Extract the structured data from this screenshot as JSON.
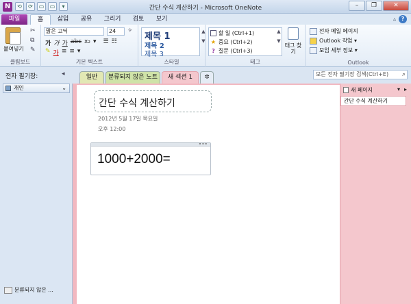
{
  "window": {
    "title": "간단 수식 계산하기 - Microsoft OneNote",
    "logo": "N"
  },
  "qat": [
    "⟲",
    "⟳",
    "▭",
    "▭",
    "▾"
  ],
  "winbtns": {
    "minimize": "–",
    "restore": "❐",
    "close": "✕"
  },
  "ribbon_tabs": {
    "file": "파일",
    "tabs": [
      "홈",
      "삽입",
      "공유",
      "그리기",
      "검토",
      "보기"
    ],
    "active": "홈"
  },
  "clipboard": {
    "paste": "붙여넣기",
    "group": "클립보드"
  },
  "basic_text": {
    "font": "맑은 고딕",
    "size": "24",
    "group": "기본 텍스트",
    "row1": [
      "가",
      "가",
      "가",
      "abc",
      "x₂",
      "▾"
    ],
    "row2": [
      "✎",
      "가",
      "≡",
      "≡",
      "▾"
    ]
  },
  "styles": {
    "h1": "제목 1",
    "h2": "제목 2",
    "h3": "제목 3",
    "group": "스타일"
  },
  "tags": {
    "items": [
      "할 일 (Ctrl+1)",
      "중요 (Ctrl+2)",
      "질문 (Ctrl+3)"
    ],
    "find": "태그 찾기",
    "group": "태그"
  },
  "outlook": {
    "items": [
      "전자 메일 페이지",
      "Outlook 작업 ▾",
      "모임 세부 정보 ▾"
    ],
    "group": "Outlook"
  },
  "notebook_bar": {
    "label": "전자 필기장:",
    "collapse": "◂",
    "sections": [
      "일반",
      "분류되지 않은 노트",
      "새 섹션 1"
    ],
    "add": "✲",
    "search_placeholder": "모든 전자 필기장 검색(Ctrl+E)",
    "search_icon": "⌕"
  },
  "left_panel": {
    "notebook": "개인",
    "unfiled": "분류되지 않은 ..."
  },
  "page": {
    "title": "간단 수식 계산하기",
    "date": "2012년 5월 17일 목요일",
    "time": "오후 12:00",
    "note": "1000+2000="
  },
  "page_panel": {
    "new_page": "새 페이지",
    "arrows": [
      "▾",
      "▸"
    ],
    "pages": [
      "간단 수식 계산하기"
    ]
  }
}
